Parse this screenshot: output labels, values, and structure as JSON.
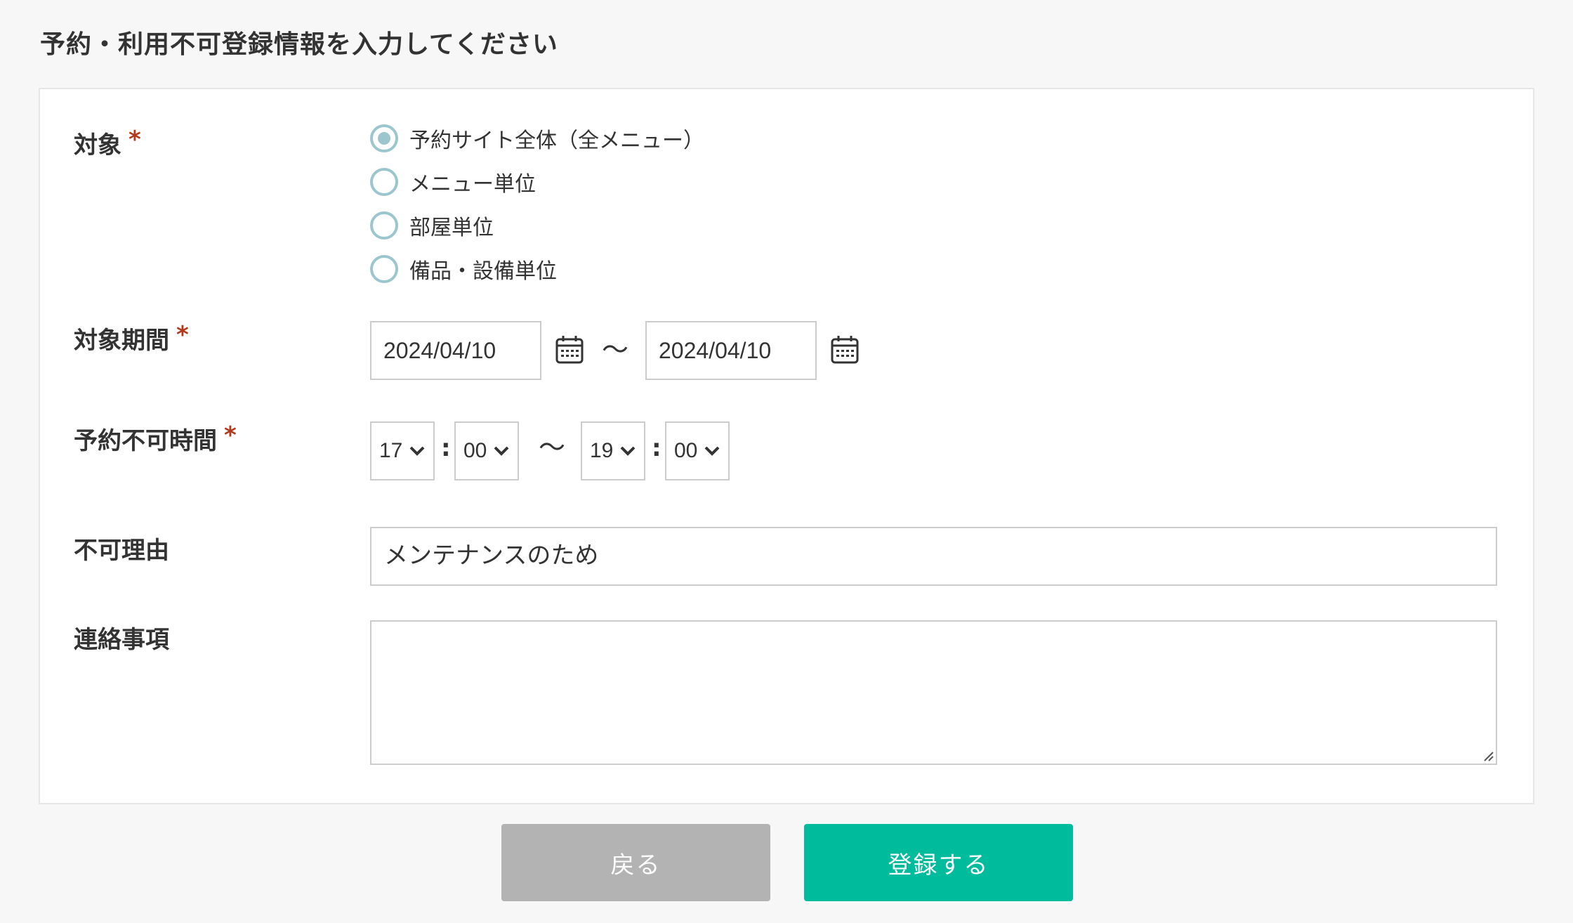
{
  "page": {
    "title": "予約・利用不可登録情報を入力してください"
  },
  "colors": {
    "background": "#f7f7f7",
    "required_mark": "#b23a1c",
    "radio_accent": "#9cc6ce",
    "back_button": "#b3b3b3",
    "register_button": "#00bb9c"
  },
  "form": {
    "required_mark": "*",
    "target": {
      "label": "対象",
      "options": [
        {
          "label": "予約サイト全体（全メニュー）",
          "checked": true
        },
        {
          "label": "メニュー単位",
          "checked": false
        },
        {
          "label": "部屋単位",
          "checked": false
        },
        {
          "label": "備品・設備単位",
          "checked": false
        }
      ]
    },
    "period": {
      "label": "対象期間",
      "start": "2024/04/10",
      "separator": "〜",
      "end": "2024/04/10",
      "calendar_icon": "calendar-icon"
    },
    "time": {
      "label": "予約不可時間",
      "start_hour": "17",
      "start_minute": "00",
      "colon": ":",
      "separator": "〜",
      "end_hour": "19",
      "end_minute": "00",
      "dropdown_icon": "chevron-down-icon"
    },
    "reason": {
      "label": "不可理由",
      "value": "メンテナンスのため"
    },
    "notes": {
      "label": "連絡事項",
      "value": ""
    }
  },
  "buttons": {
    "back_label": "戻る",
    "register_label": "登録する"
  }
}
